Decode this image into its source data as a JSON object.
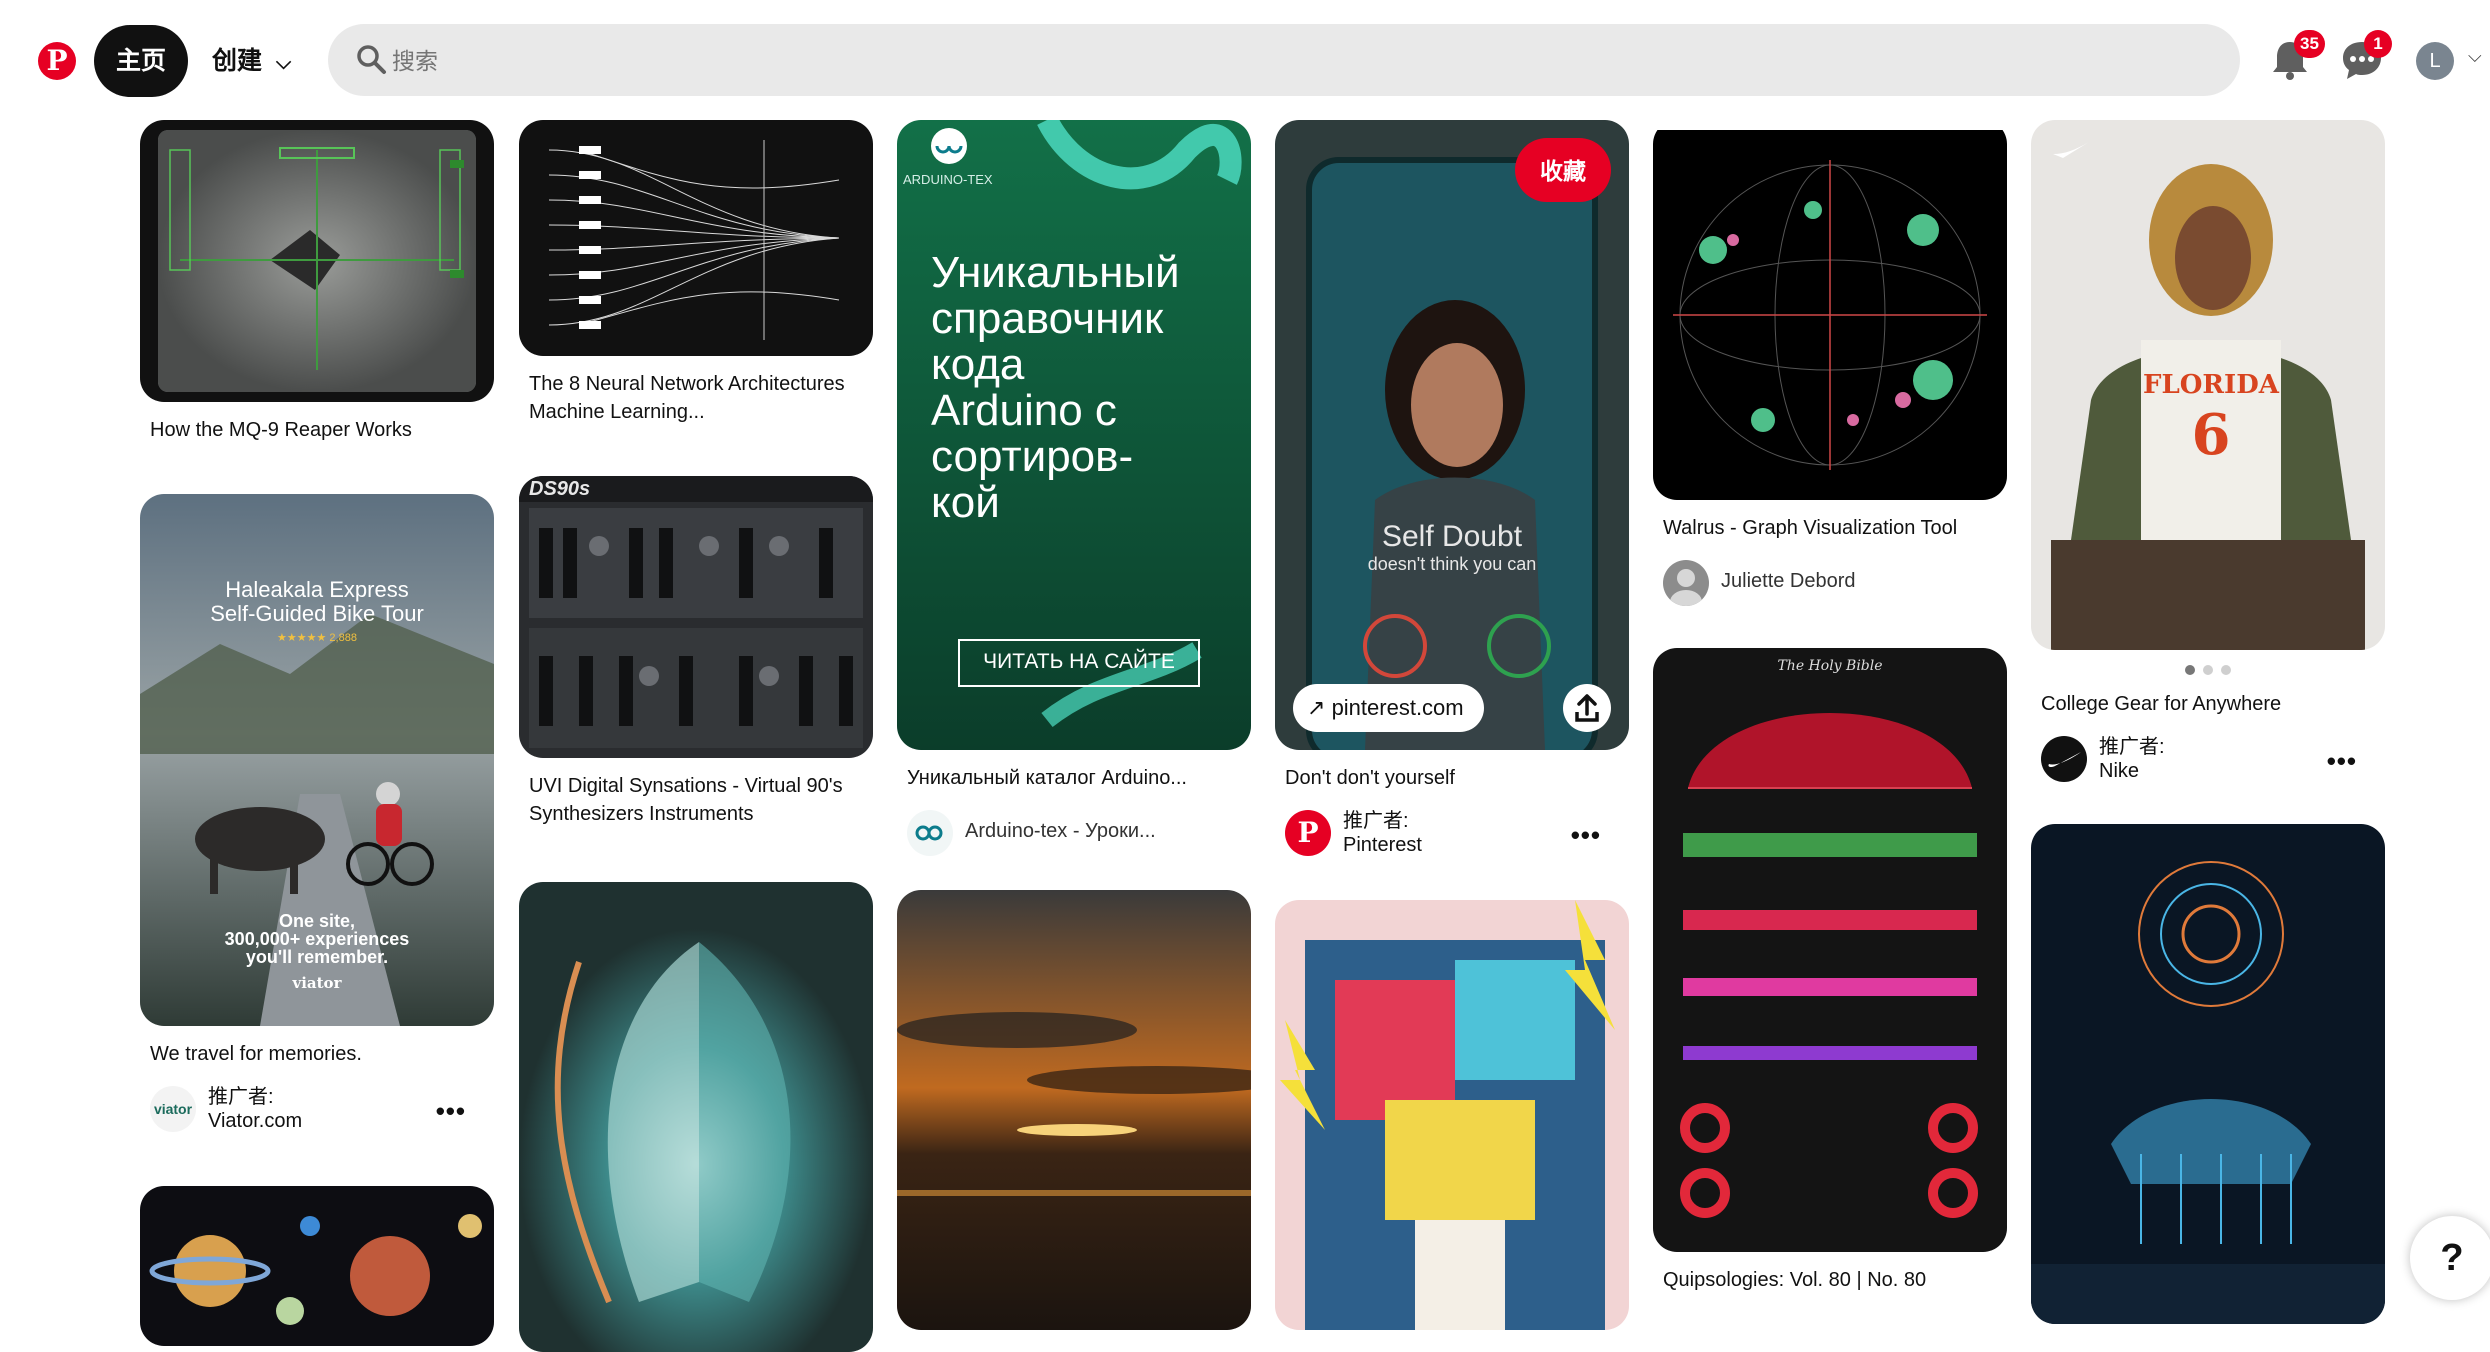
{
  "header": {
    "home_label": "主页",
    "create_label": "创建",
    "search_placeholder": "搜索",
    "notifications_count": "35",
    "messages_count": "1",
    "avatar_initial": "L"
  },
  "colors": {
    "brand": "#e60023",
    "search_bg": "#e9e9e9",
    "nav_active_bg": "#111111"
  },
  "icons": [
    "pinterest-logo",
    "chevron-down-icon",
    "search-icon",
    "bell-icon",
    "chat-icon",
    "chevron-down-icon",
    "ellipsis-icon",
    "arrow-up-right-icon",
    "share-icon"
  ],
  "pins": {
    "p1": {
      "title": "How the MQ-9 Reaper Works"
    },
    "p2": {
      "title": "We travel for memories.",
      "promoted_label": "推广者:",
      "advertiser": "Viator.com",
      "avatar_text": "viator",
      "overlay_title": "Haleakala Express",
      "overlay_subtitle": "Self-Guided Bike Tour",
      "overlay_rating": "★★★★★ 2,888",
      "overlay_line1": "One site,",
      "overlay_line2": "300,000+ experiences",
      "overlay_line3": "you'll remember.",
      "overlay_brand": "viator"
    },
    "p4": {
      "title": "The 8 Neural Network Architectures Machine Learning..."
    },
    "p5": {
      "title": "UVI Digital Synsations - Virtual 90's Synthesizers Instruments",
      "image_label": "DS90s"
    },
    "p7": {
      "title": "Уникальный каталог Arduino...",
      "author": "Arduino-tex - Уроки...",
      "brand_text": "ARDUINO-TEX",
      "img_line1": "Уникальный",
      "img_line2": "справочник",
      "img_line3": "кода",
      "img_line4": "Arduino с",
      "img_line5": "сортиров-",
      "img_line6": "кой",
      "cta": "ЧИТАТЬ НА САЙТЕ"
    },
    "p9": {
      "title": "Don't don't yourself",
      "promoted_label": "推广者:",
      "advertiser": "Pinterest",
      "save_label": "收藏",
      "link_text": "pinterest.com",
      "img_line1": "Self Doubt",
      "img_line2": "doesn't think you can"
    },
    "p11": {
      "title": "Walrus - Graph Visualization Tool",
      "author": "Juliette Debord"
    },
    "p12": {
      "title": "Quipsologies: Vol. 80 | No. 80",
      "img_title": "The Holy Bible"
    },
    "p13": {
      "title": "College Gear for Anywhere",
      "promoted_label": "推广者:",
      "advertiser": "Nike",
      "shirt_text": "FLORIDA",
      "shirt_number": "6"
    }
  }
}
